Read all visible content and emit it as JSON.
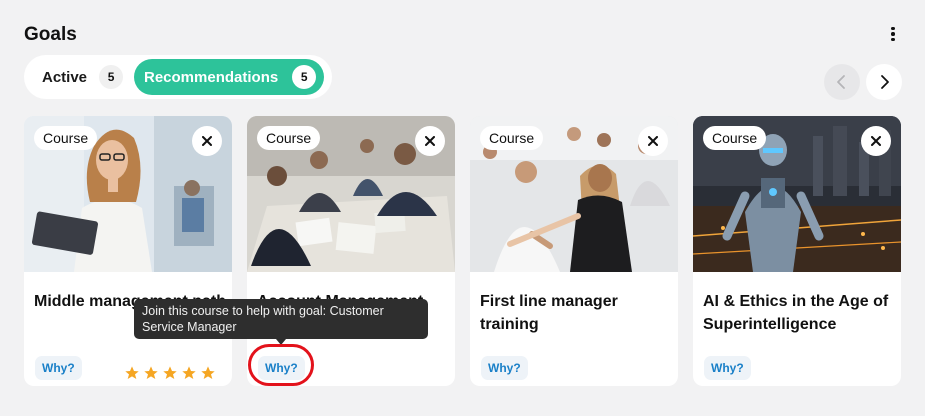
{
  "header": {
    "title": "Goals",
    "menu_icon": "kebab-menu-icon"
  },
  "tabs": [
    {
      "label": "Active",
      "count": "5"
    },
    {
      "label": "Recommendations",
      "count": "5"
    }
  ],
  "nav": {
    "prev_icon": "chevron-left-icon",
    "next_icon": "chevron-right-icon"
  },
  "cards": [
    {
      "badge": "Course",
      "title": "Middle management path",
      "why": "Why?",
      "rating": 5
    },
    {
      "badge": "Course",
      "title": "Account Management",
      "why": "Why?"
    },
    {
      "badge": "Course",
      "title": "First line manager training",
      "why": "Why?"
    },
    {
      "badge": "Course",
      "title": "AI & Ethics in the Age of Superintelligence",
      "why": "Why?"
    }
  ],
  "tooltip": {
    "text": "Join this course to help with goal: Customer Service Manager"
  },
  "colors": {
    "accent": "#2dc39a",
    "why_text": "#1a80c8",
    "star": "#f5a623",
    "highlight": "#e3121b",
    "tooltip_bg": "#2e2e2e"
  }
}
